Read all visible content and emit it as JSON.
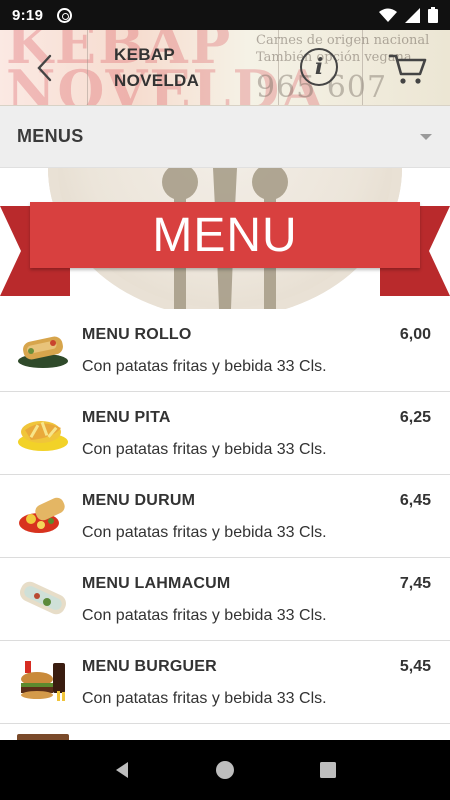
{
  "status_bar": {
    "time": "9:19"
  },
  "header": {
    "title_line1": "KEBAP",
    "title_line2": "NOVELDA",
    "bg_brand_line1": "KEBAP",
    "bg_brand_line2": "NOVELDA",
    "bg_note_line1": "Carnes de origen nacional",
    "bg_note_line2": "También opción vegana",
    "bg_phone": "965 607 582",
    "icons": {
      "back": "chevron-left-icon",
      "info": "info-icon",
      "cart": "cart-icon"
    }
  },
  "category": {
    "label": "MENUS",
    "icon": "dropdown-arrow-icon"
  },
  "banner": {
    "text": "MENU"
  },
  "items": [
    {
      "name": "MENU ROLLO",
      "description": "Con patatas fritas y bebida 33 Cls.",
      "price": "6,00",
      "thumb": "rollo"
    },
    {
      "name": "MENU PITA",
      "description": "Con patatas fritas y bebida 33 Cls.",
      "price": "6,25",
      "thumb": "pita"
    },
    {
      "name": "MENU DURUM",
      "description": "Con patatas fritas y bebida 33 Cls.",
      "price": "6,45",
      "thumb": "durum"
    },
    {
      "name": "MENU LAHMACUM",
      "description": "Con patatas fritas y bebida 33 Cls.",
      "price": "7,45",
      "thumb": "lahmacum"
    },
    {
      "name": "MENU BURGUER",
      "description": "Con patatas fritas y bebida 33 Cls.",
      "price": "5,45",
      "thumb": "burguer"
    }
  ],
  "colors": {
    "ribbon": "#d8403f",
    "ribbon_dark": "#b92a2c",
    "category_bg": "#eeeeee",
    "text": "#333333"
  }
}
